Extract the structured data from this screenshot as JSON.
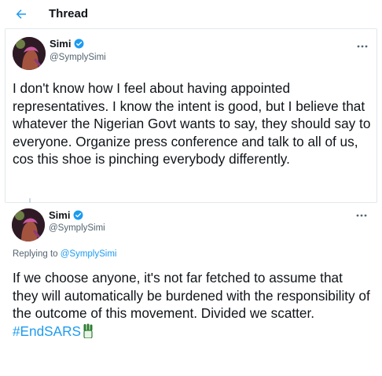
{
  "header": {
    "title": "Thread"
  },
  "tweets": [
    {
      "name": "Simi",
      "handle": "@SymplySimi",
      "text": "I don't know how I feel about having appointed representatives. I know the intent is good, but I believe that whatever the Nigerian Govt wants to say, they should say to everyone. Organize press conference and talk to all of us, cos this shoe is pinching everybody differently."
    },
    {
      "name": "Simi",
      "handle": "@SymplySimi",
      "replying_prefix": "Replying to ",
      "replying_to": "@SymplySimi",
      "text": "If we choose anyone, it's not far fetched to assume that they will automatically be burdened with the responsibility of the outcome of this movement. Divided we scatter. ",
      "hashtag": "#EndSARS"
    }
  ],
  "colors": {
    "accent": "#1d9bf0",
    "text": "#0f1419",
    "muted": "#536471",
    "border": "#e1e8ed"
  },
  "icons": {
    "back": "back-arrow-icon",
    "verified": "verified-badge-icon",
    "more": "more-options-icon",
    "fist": "raised-fist-emoji"
  }
}
